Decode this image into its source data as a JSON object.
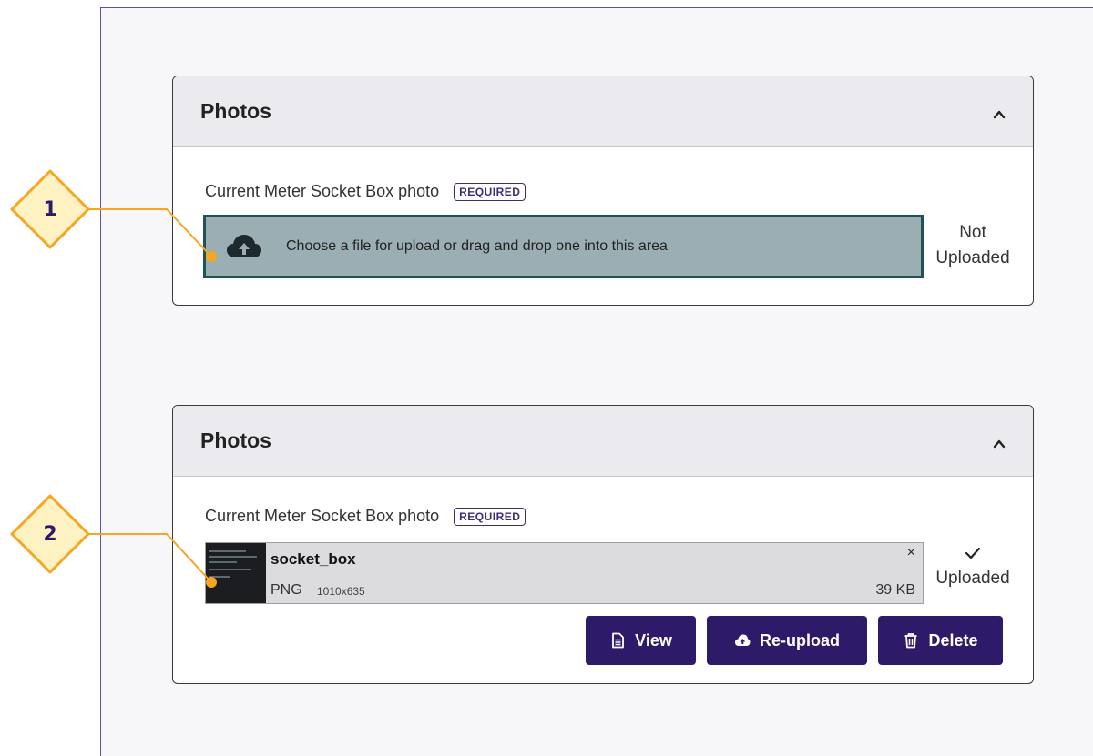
{
  "panels": [
    {
      "title": "Photos",
      "field_label": "Current Meter Socket Box photo",
      "badge": "REQUIRED",
      "dropzone_text": "Choose a file for upload or drag and drop one into this area",
      "status_line1": "Not",
      "status_line2": "Uploaded"
    },
    {
      "title": "Photos",
      "field_label": "Current Meter Socket Box photo",
      "badge": "REQUIRED",
      "file": {
        "name": "socket_box",
        "type": "PNG",
        "dimensions": "1010x635",
        "size": "39 KB",
        "close": "×"
      },
      "status": "Uploaded",
      "buttons": {
        "view": "View",
        "reupload": "Re-upload",
        "delete": "Delete"
      }
    }
  ],
  "callouts": [
    "1",
    "2"
  ],
  "colors": {
    "accent": "#2d1b69",
    "callout_fill": "#fff2c2",
    "callout_stroke": "#f5a623",
    "dropzone": "#9aaeb3",
    "dropzone_border": "#1f5257"
  },
  "icons": {
    "collapse": "chevron-up-icon",
    "upload": "cloud-upload-icon",
    "uploaded": "check-icon",
    "view": "document-icon",
    "reupload": "cloud-upload-icon",
    "delete": "trash-icon"
  }
}
